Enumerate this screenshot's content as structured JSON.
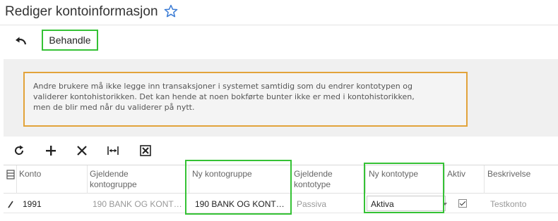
{
  "header": {
    "title": "Rediger kontoinformasjon",
    "star_icon": "star-outline-icon",
    "star_color": "#3a7bd5"
  },
  "toolbar": {
    "undo_icon": "undo-icon",
    "process_label": "Behandle"
  },
  "warning": {
    "lines": [
      "Andre brukere må ikke legge inn transaksjoner i systemet samtidig som du endrer kontotypen og",
      "validerer kontohistorikken. Det kan hende at noen bokførte bunter ikke er med i kontohistorikken,",
      "men de blir med når du validerer på nytt."
    ],
    "border_color": "#e2a33a"
  },
  "grid_toolbar": {
    "icons": [
      "refresh-icon",
      "add-icon",
      "delete-icon",
      "fit-columns-icon",
      "export-excel-icon"
    ]
  },
  "grid": {
    "headers": {
      "konto": "Konto",
      "gjeldende_kontogruppe": [
        "Gjeldende",
        "kontogruppe"
      ],
      "ny_kontogruppe": "Ny kontogruppe",
      "gjeldende_kontotype": [
        "Gjeldende",
        "kontotype"
      ],
      "ny_kontotype": "Ny kontotype",
      "aktiv": "Aktiv",
      "beskrivelse": "Beskrivelse"
    },
    "rows": [
      {
        "konto": "1991",
        "gjeldende_kontogruppe": "190 BANK OG KONT…",
        "ny_kontogruppe": "190 BANK OG KONT…",
        "gjeldende_kontotype": "Passiva",
        "ny_kontotype": "Aktiva",
        "aktiv": true,
        "beskrivelse": "Testkonto"
      }
    ]
  },
  "highlight_color": "#35c235"
}
